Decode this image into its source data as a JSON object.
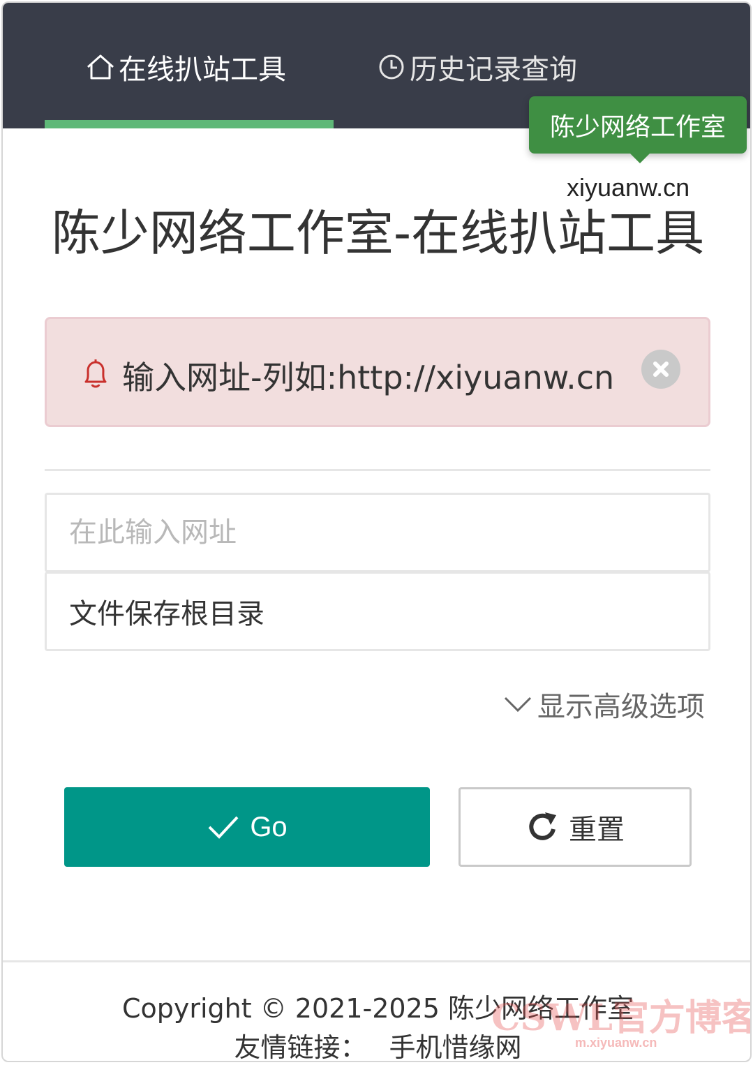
{
  "nav": {
    "tabs": [
      {
        "label": "在线扒站工具",
        "icon": "home-icon",
        "active": true
      },
      {
        "label": "历史记录查询",
        "icon": "clock-icon",
        "active": false
      }
    ],
    "active_color": "#5fb878",
    "background": "#393d49"
  },
  "tooltip": {
    "text": "陈少网络工作室",
    "domain": "xiyuanw.cn"
  },
  "main": {
    "title": "陈少网络工作室-在线扒站工具",
    "alert": {
      "text": "输入网址-列如:http://xiyuanw.cn",
      "icon": "bell-icon"
    },
    "url_field": {
      "placeholder": "在此输入网址",
      "value": ""
    },
    "dir_field": {
      "value": "文件保存根目录"
    },
    "advanced_toggle": "显示高级选项",
    "go_button": "Go",
    "reset_button": "重置"
  },
  "footer": {
    "copyright": "Copyright © 2021-2025 陈少网络工作室",
    "links_label": "友情链接：",
    "links": [
      "手机惜缘网"
    ],
    "watermark": "CSWL官方博客",
    "watermark_sub": "m.xiyuanw.cn"
  }
}
